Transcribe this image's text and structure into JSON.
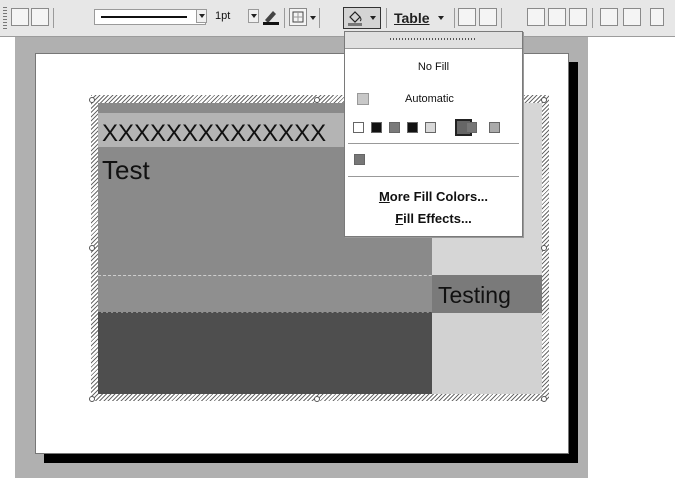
{
  "toolbar": {
    "line_weight": "1pt",
    "table_menu": "Table"
  },
  "table": {
    "header_text": "XXXXXXXXXXXXXX",
    "cell_test": "Test",
    "cell_testing": "Testing"
  },
  "fill_menu": {
    "no_fill": "No Fill",
    "automatic": "Automatic",
    "more_colors_prefix": "M",
    "more_colors_rest": "ore Fill Colors...",
    "fill_effects_prefix": "F",
    "fill_effects_rest": "ill Effects...",
    "swatches": [
      "#ffffff",
      "#111111",
      "#7a7a7a",
      "#111111",
      "#d8d8d8",
      "#666666",
      "#777777",
      "#aaaaaa"
    ],
    "recent_color": "#777777"
  }
}
